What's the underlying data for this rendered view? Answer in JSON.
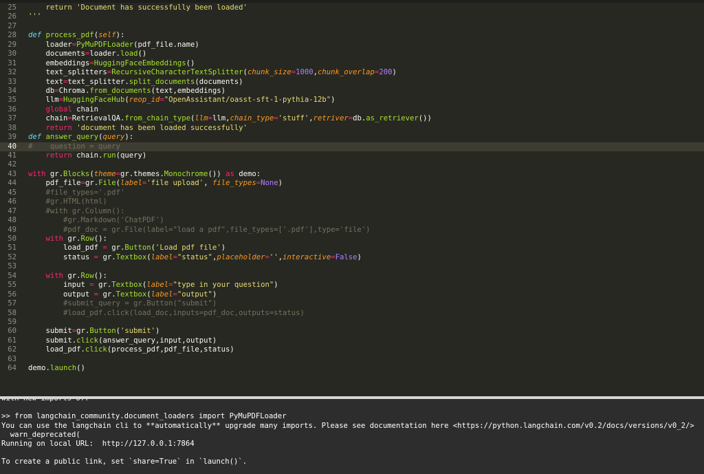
{
  "editor": {
    "lines": [
      {
        "num": "25",
        "html": "    <span class=\"s\">return 'Document has successfully been loaded'</span>"
      },
      {
        "num": "26",
        "html": "<span class=\"s\">'''</span>"
      },
      {
        "num": "27",
        "html": ""
      },
      {
        "num": "28",
        "html": "<span class=\"d\">def</span> <span class=\"f\">process_pdf</span>(<span class=\"p\">self</span>):"
      },
      {
        "num": "29",
        "html": "    loader<span class=\"k\">=</span><span class=\"f\">PyMuPDFLoader</span>(pdf_file.name)"
      },
      {
        "num": "30",
        "html": "    documents<span class=\"k\">=</span>loader.<span class=\"f\">load</span>()"
      },
      {
        "num": "31",
        "html": "    embeddings<span class=\"k\">=</span><span class=\"f\">HuggingFaceEmbeddings</span>()"
      },
      {
        "num": "32",
        "html": "    text_splitters<span class=\"k\">=</span><span class=\"f\">RecursiveCharacterTextSplitter</span>(<span class=\"p\">chunk_size</span><span class=\"k\">=</span><span class=\"n\">1000</span>,<span class=\"p\">chunk_overlap</span><span class=\"k\">=</span><span class=\"n\">200</span>)"
      },
      {
        "num": "33",
        "html": "    text<span class=\"k\">=</span>text_splitter.<span class=\"f\">split_documents</span>(documents)"
      },
      {
        "num": "34",
        "html": "    db<span class=\"k\">=</span>Chroma.<span class=\"f\">from_documents</span>(text,embeddings)"
      },
      {
        "num": "35",
        "html": "    llm<span class=\"k\">=</span><span class=\"f\">HuggingFaceHub</span>(<span class=\"p\">reop_id</span><span class=\"k\">=</span><span class=\"s\">\"OpenAssistant/oasst-sft-1-pythia-12b\"</span>)"
      },
      {
        "num": "36",
        "html": "    <span class=\"k\">global</span> chain"
      },
      {
        "num": "37",
        "html": "    chain<span class=\"k\">=</span>RetrievalQA.<span class=\"f\">from_chain_type</span>(<span class=\"p\">llm</span><span class=\"k\">=</span>llm,<span class=\"p\">chain_type</span><span class=\"k\">=</span><span class=\"s\">'stuff'</span>,<span class=\"p\">retriver</span><span class=\"k\">=</span>db.<span class=\"f\">as_retriever</span>())"
      },
      {
        "num": "38",
        "html": "    <span class=\"k\">return</span> <span class=\"s\">'document has been loaded successfully'</span>"
      },
      {
        "num": "39",
        "html": "<span class=\"d\">def</span> <span class=\"f\">answer_query</span>(<span class=\"p\">query</span>):"
      },
      {
        "num": "40",
        "html": "<span class=\"c\">#    question = query</span>",
        "active": true
      },
      {
        "num": "41",
        "html": "    <span class=\"k\">return</span> chain.<span class=\"f\">run</span>(query)"
      },
      {
        "num": "42",
        "html": ""
      },
      {
        "num": "43",
        "html": "<span class=\"k\">with</span> gr.<span class=\"f\">Blocks</span>(<span class=\"p\">theme</span><span class=\"k\">=</span>gr.themes.<span class=\"f\">Monochrome</span>()) <span class=\"k\">as</span> demo:"
      },
      {
        "num": "44",
        "html": "    pdf_file<span class=\"k\">=</span>gr.<span class=\"f\">File</span>(<span class=\"p\">label</span><span class=\"k\">=</span><span class=\"s\">'file upload'</span>, <span class=\"p\">file_types</span><span class=\"k\">=</span><span class=\"n\">None</span>)"
      },
      {
        "num": "45",
        "html": "    <span class=\"c\">#file_types='.pdf'</span>"
      },
      {
        "num": "46",
        "html": "    <span class=\"c\">#gr.HTML(html)</span>"
      },
      {
        "num": "47",
        "html": "    <span class=\"c\">#with gr.Column():</span>"
      },
      {
        "num": "48",
        "html": "        <span class=\"c\">#gr.Markdown('ChatPDF')</span>"
      },
      {
        "num": "49",
        "html": "        <span class=\"c\">#pdf_doc = gr.File(label=\"load a pdf\",file_types=['.pdf'],type='file')</span>"
      },
      {
        "num": "50",
        "html": "    <span class=\"k\">with</span> gr.<span class=\"f\">Row</span>():"
      },
      {
        "num": "51",
        "html": "        load_pdf <span class=\"k\">=</span> gr.<span class=\"f\">Button</span>(<span class=\"s\">'Load pdf file'</span>)"
      },
      {
        "num": "52",
        "html": "        status <span class=\"k\">=</span> gr.<span class=\"f\">Textbox</span>(<span class=\"p\">label</span><span class=\"k\">=</span><span class=\"s\">\"status\"</span>,<span class=\"p\">placeholder</span><span class=\"k\">=</span><span class=\"s\">''</span>,<span class=\"p\">interactive</span><span class=\"k\">=</span><span class=\"n\">False</span>)"
      },
      {
        "num": "53",
        "html": ""
      },
      {
        "num": "54",
        "html": "    <span class=\"k\">with</span> gr.<span class=\"f\">Row</span>():"
      },
      {
        "num": "55",
        "html": "        input <span class=\"k\">=</span> gr.<span class=\"f\">Textbox</span>(<span class=\"p\">label</span><span class=\"k\">=</span><span class=\"s\">\"type in your question\"</span>)"
      },
      {
        "num": "56",
        "html": "        output <span class=\"k\">=</span> gr.<span class=\"f\">Textbox</span>(<span class=\"p\">label</span><span class=\"k\">=</span><span class=\"s\">\"output\"</span>)"
      },
      {
        "num": "57",
        "html": "        <span class=\"c\">#submit_query = gr.Button(\"submit\")</span>"
      },
      {
        "num": "58",
        "html": "        <span class=\"c\">#load_pdf.click(load_doc,inputs=pdf_doc,outputs=status)</span>"
      },
      {
        "num": "59",
        "html": ""
      },
      {
        "num": "60",
        "html": "    submit<span class=\"k\">=</span>gr.<span class=\"f\">Button</span>(<span class=\"s\">'submit'</span>)"
      },
      {
        "num": "61",
        "html": "    submit.<span class=\"f\">click</span>(answer_query,input,output)"
      },
      {
        "num": "62",
        "html": "    load_pdf.<span class=\"f\">click</span>(process_pdf,pdf_file,status)"
      },
      {
        "num": "63",
        "html": ""
      },
      {
        "num": "64",
        "html": "demo.<span class=\"f\">launch</span>()"
      }
    ]
  },
  "terminal": {
    "lines": [
      "with new imports of:",
      "",
      ">> from langchain_community.document_loaders import PyMuPDFLoader",
      "You can use the langchain cli to **automatically** upgrade many imports. Please see documentation here <https://python.langchain.com/v0.2/docs/versions/v0_2/>",
      "  warn_deprecated(",
      "Running on local URL:  http://127.0.0.1:7864",
      "",
      "To create a public link, set `share=True` in `launch()`."
    ]
  }
}
